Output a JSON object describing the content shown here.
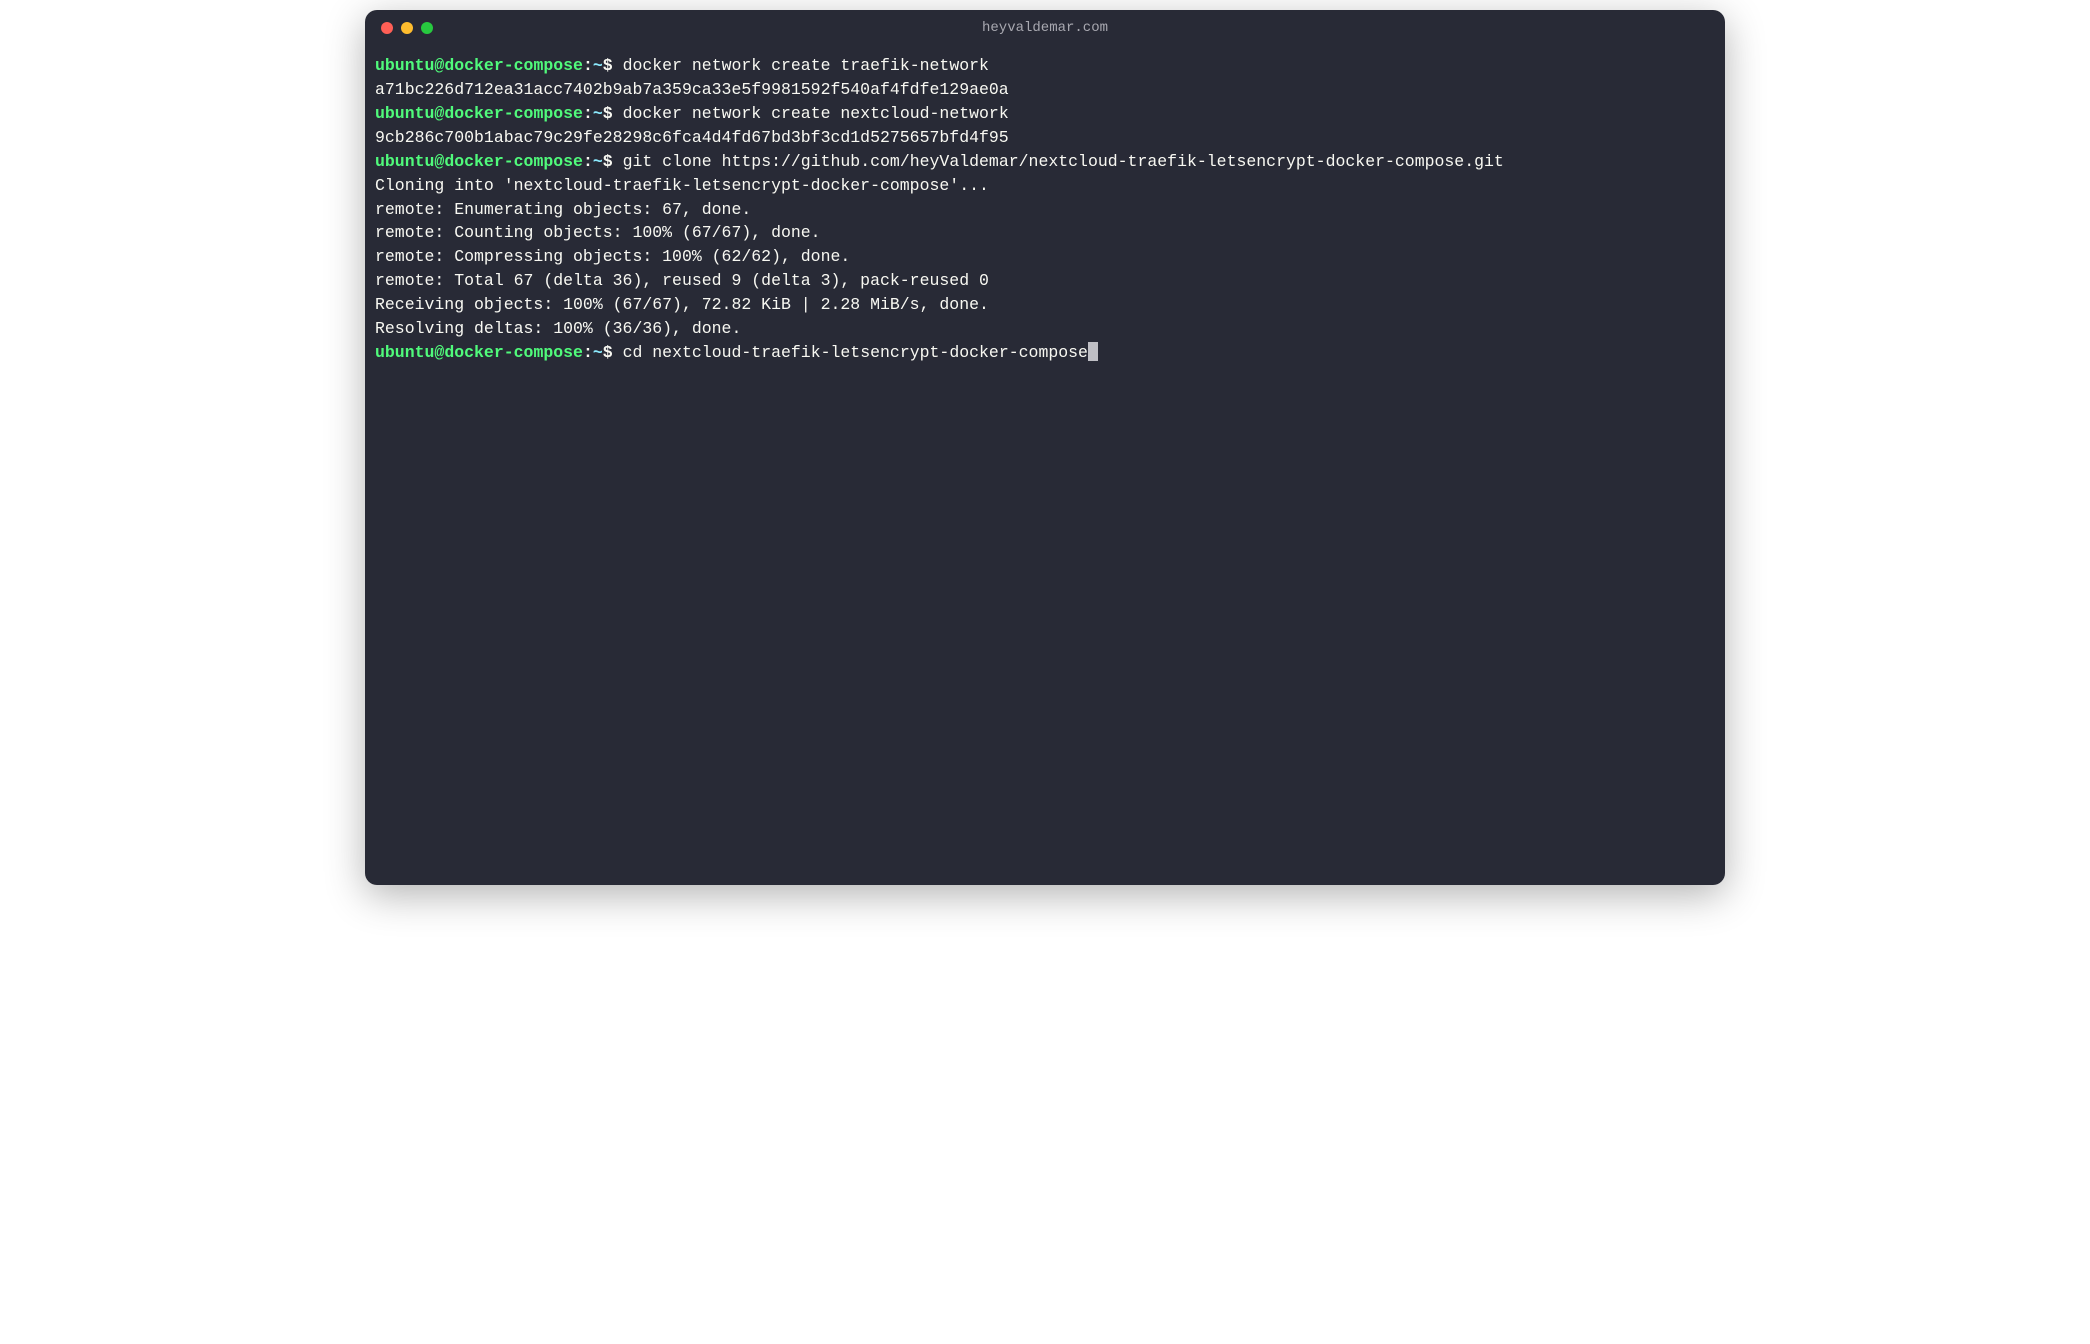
{
  "window": {
    "title": "heyvaldemar.com"
  },
  "prompt": {
    "user": "ubuntu",
    "at": "@",
    "host": "docker-compose",
    "colon": ":",
    "path": "~",
    "dollar": "$"
  },
  "lines": [
    {
      "type": "cmd",
      "command": "docker network create traefik-network"
    },
    {
      "type": "out",
      "text": "a71bc226d712ea31acc7402b9ab7a359ca33e5f9981592f540af4fdfe129ae0a"
    },
    {
      "type": "cmd",
      "command": "docker network create nextcloud-network"
    },
    {
      "type": "out",
      "text": "9cb286c700b1abac79c29fe28298c6fca4d4fd67bd3bf3cd1d5275657bfd4f95"
    },
    {
      "type": "cmd",
      "command": "git clone https://github.com/heyValdemar/nextcloud-traefik-letsencrypt-docker-compose.git"
    },
    {
      "type": "out",
      "text": "Cloning into 'nextcloud-traefik-letsencrypt-docker-compose'..."
    },
    {
      "type": "out",
      "text": "remote: Enumerating objects: 67, done."
    },
    {
      "type": "out",
      "text": "remote: Counting objects: 100% (67/67), done."
    },
    {
      "type": "out",
      "text": "remote: Compressing objects: 100% (62/62), done."
    },
    {
      "type": "out",
      "text": "remote: Total 67 (delta 36), reused 9 (delta 3), pack-reused 0"
    },
    {
      "type": "out",
      "text": "Receiving objects: 100% (67/67), 72.82 KiB | 2.28 MiB/s, done."
    },
    {
      "type": "out",
      "text": "Resolving deltas: 100% (36/36), done."
    },
    {
      "type": "cmd_cursor",
      "command": "cd nextcloud-traefik-letsencrypt-docker-compose"
    }
  ]
}
